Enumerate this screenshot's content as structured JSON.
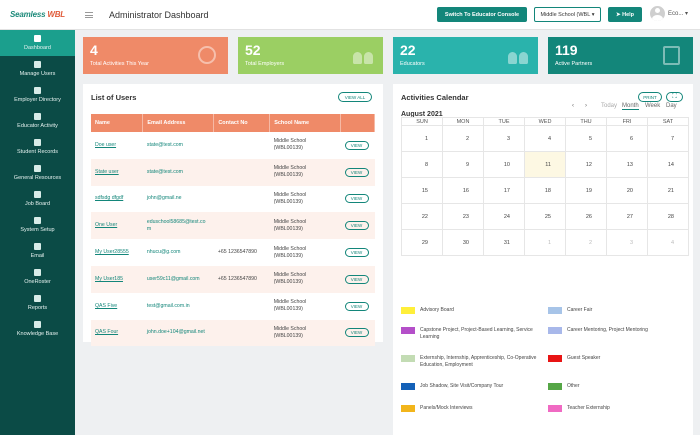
{
  "app": {
    "logo_main": "Seamless",
    "logo_accent": "WBL",
    "page_title": "Administrator Dashboard"
  },
  "topbar": {
    "switch_label": "Switch To Educator Console",
    "school_selected": "Middle School (WBL",
    "help_label": "Help",
    "user_name": "Eco..."
  },
  "sidebar": {
    "items": [
      {
        "label": "Dashboard",
        "active": true
      },
      {
        "label": "Manage Users"
      },
      {
        "label": "Employer Directory"
      },
      {
        "label": "Educator Activity"
      },
      {
        "label": "Student Records"
      },
      {
        "label": "General Resources"
      },
      {
        "label": "Job Board"
      },
      {
        "label": "System Setup"
      },
      {
        "label": "Email"
      },
      {
        "label": "OneRoster"
      },
      {
        "label": "Reports"
      },
      {
        "label": "Knowledge Base"
      }
    ]
  },
  "stats": [
    {
      "value": "4",
      "label": "Total Activities This Year",
      "color": "#ef8a68",
      "icon": "globe-icon"
    },
    {
      "value": "52",
      "label": "Total Employers",
      "color": "#9bcf63",
      "icon": "people-icon"
    },
    {
      "value": "22",
      "label": "Educators",
      "color": "#2ab3ac",
      "icon": "people-icon"
    },
    {
      "value": "119",
      "label": "Active Partners",
      "color": "#13867a",
      "icon": "frame-icon"
    }
  ],
  "users": {
    "title": "List of Users",
    "view_all": "VIEW ALL",
    "columns": [
      "Name",
      "Email Address",
      "Contact No",
      "School Name"
    ],
    "view_label": "VIEW",
    "rows": [
      {
        "name": "Doe user",
        "email": "state@test.com",
        "contact": "",
        "school_1": "Middle School",
        "school_2": "(WBL00139)"
      },
      {
        "name": "State user",
        "email": "state@test.com",
        "contact": "",
        "school_1": "Middle School",
        "school_2": "(WBL00139)"
      },
      {
        "name": "sdfsdg dfgdf",
        "email": "john@gmail.ne",
        "contact": "",
        "school_1": "Middle School",
        "school_2": "(WBL00139)"
      },
      {
        "name": "One User",
        "email_1": "eduschool58685@test.co",
        "email_2": "m",
        "contact": "",
        "school_1": "Middle School",
        "school_2": "(WBL00139)"
      },
      {
        "name": "My User28555",
        "email": "nhucu@g.com",
        "contact": "+65 1236547890",
        "school_1": "Middle School",
        "school_2": "(WBL00139)"
      },
      {
        "name": "My User185",
        "email": "user59c11@gmail.com",
        "contact": "+65 1236547890",
        "school_1": "Middle School",
        "school_2": "(WBL00139)"
      },
      {
        "name": "QAS Five",
        "email": "test@gmail.com.in",
        "contact": "",
        "school_1": "Middle School",
        "school_2": "(WBL00139)"
      },
      {
        "name": "QAS Four",
        "email": "john.doe+104@gmail.net",
        "contact": "",
        "school_1": "Middle School",
        "school_2": "(WBL00139)"
      }
    ]
  },
  "calendar": {
    "title": "Activities Calendar",
    "print_label": "PRINT",
    "month_label": "August 2021",
    "nav_prev": "‹",
    "nav_next": "›",
    "today_label": "Today",
    "views": [
      "Month",
      "Week",
      "Day"
    ],
    "active_view": "Month",
    "weekdays": [
      "SUN",
      "MON",
      "TUE",
      "WED",
      "THU",
      "FRI",
      "SAT"
    ],
    "weeks": [
      [
        "1",
        "2",
        "3",
        "4",
        "5",
        "6",
        "7"
      ],
      [
        "8",
        "9",
        "10",
        "11",
        "12",
        "13",
        "14"
      ],
      [
        "15",
        "16",
        "17",
        "18",
        "19",
        "20",
        "21"
      ],
      [
        "22",
        "23",
        "24",
        "25",
        "26",
        "27",
        "28"
      ],
      [
        "29",
        "30",
        "31",
        "1",
        "2",
        "3",
        "4"
      ]
    ],
    "today": "11",
    "legend": [
      {
        "label": "Advisory Board",
        "color": "#ffef3a"
      },
      {
        "label": "Career Fair",
        "color": "#a7c4e8"
      },
      {
        "label": "Capstone Project, Project-Based Learning, Service Learning",
        "color": "#b44fc9"
      },
      {
        "label": "Career Mentoring, Project Mentoring",
        "color": "#a8b8ea"
      },
      {
        "label": "Externship, Internship, Apprenticeship, Co-Operative Education, Employment",
        "color": "#c3dcb4"
      },
      {
        "label": "Guest Speaker",
        "color": "#e81414"
      },
      {
        "label": "Job Shadow, Site Visit/Company Tour",
        "color": "#1461b8"
      },
      {
        "label": "Other",
        "color": "#55a646"
      },
      {
        "label": "Panels/Mock Interviews",
        "color": "#f2b51b"
      },
      {
        "label": "Teacher Externship",
        "color": "#f06ac3"
      }
    ]
  }
}
